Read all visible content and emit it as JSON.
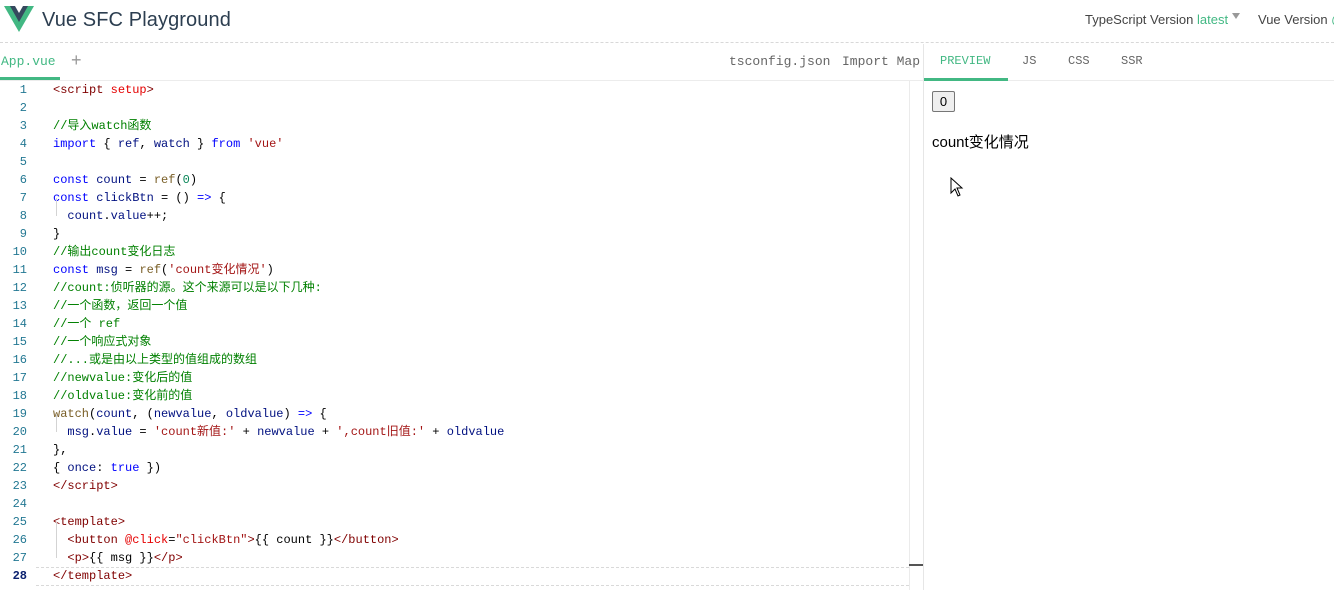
{
  "header": {
    "title": "Vue SFC Playground",
    "ts_label": "TypeScript Version",
    "ts_value": "latest",
    "vue_label": "Vue Version",
    "vue_value": "@"
  },
  "editor_tabs": {
    "active_file": "App.vue",
    "add_label": "+",
    "tsconfig": "tsconfig.json",
    "import_map": "Import Map"
  },
  "preview_tabs": [
    "PREVIEW",
    "JS",
    "CSS",
    "SSR"
  ],
  "editor": {
    "active_line": 28,
    "lines": [
      [
        [
          "c-angle",
          "<"
        ],
        [
          "c-tag",
          "script"
        ],
        [
          "c-plain",
          " "
        ],
        [
          "c-attr",
          "setup"
        ],
        [
          "c-angle",
          ">"
        ]
      ],
      [],
      [
        [
          "c-cmt",
          "//导入watch函数"
        ]
      ],
      [
        [
          "c-kw",
          "import"
        ],
        [
          "c-plain",
          " { "
        ],
        [
          "c-var",
          "ref"
        ],
        [
          "c-plain",
          ", "
        ],
        [
          "c-var",
          "watch"
        ],
        [
          "c-plain",
          " } "
        ],
        [
          "c-kw",
          "from"
        ],
        [
          "c-plain",
          " "
        ],
        [
          "c-str",
          "'vue'"
        ]
      ],
      [],
      [
        [
          "c-kw",
          "const"
        ],
        [
          "c-plain",
          " "
        ],
        [
          "c-var",
          "count"
        ],
        [
          "c-plain",
          " = "
        ],
        [
          "c-fn",
          "ref"
        ],
        [
          "c-plain",
          "("
        ],
        [
          "c-num",
          "0"
        ],
        [
          "c-plain",
          ")"
        ]
      ],
      [
        [
          "c-kw",
          "const"
        ],
        [
          "c-plain",
          " "
        ],
        [
          "c-var",
          "clickBtn"
        ],
        [
          "c-plain",
          " = () "
        ],
        [
          "c-kw",
          "=>"
        ],
        [
          "c-plain",
          " {"
        ]
      ],
      [
        [
          "c-plain",
          "  "
        ],
        [
          "c-var",
          "count"
        ],
        [
          "c-plain",
          "."
        ],
        [
          "c-var",
          "value"
        ],
        [
          "c-plain",
          "++;"
        ]
      ],
      [
        [
          "c-plain",
          "}"
        ]
      ],
      [
        [
          "c-cmt",
          "//输出count变化日志"
        ]
      ],
      [
        [
          "c-kw",
          "const"
        ],
        [
          "c-plain",
          " "
        ],
        [
          "c-var",
          "msg"
        ],
        [
          "c-plain",
          " = "
        ],
        [
          "c-fn",
          "ref"
        ],
        [
          "c-plain",
          "("
        ],
        [
          "c-str",
          "'count变化情况'"
        ],
        [
          "c-plain",
          ")"
        ]
      ],
      [
        [
          "c-cmt",
          "//count:侦听器的源。这个来源可以是以下几种:"
        ]
      ],
      [
        [
          "c-cmt",
          "//一个函数，返回一个值"
        ]
      ],
      [
        [
          "c-cmt",
          "//一个 ref"
        ]
      ],
      [
        [
          "c-cmt",
          "//一个响应式对象"
        ]
      ],
      [
        [
          "c-cmt",
          "//...或是由以上类型的值组成的数组"
        ]
      ],
      [
        [
          "c-cmt",
          "//newvalue:变化后的值"
        ]
      ],
      [
        [
          "c-cmt",
          "//oldvalue:变化前的值"
        ]
      ],
      [
        [
          "c-fn",
          "watch"
        ],
        [
          "c-plain",
          "("
        ],
        [
          "c-var",
          "count"
        ],
        [
          "c-plain",
          ", ("
        ],
        [
          "c-var",
          "newvalue"
        ],
        [
          "c-plain",
          ", "
        ],
        [
          "c-var",
          "oldvalue"
        ],
        [
          "c-plain",
          ") "
        ],
        [
          "c-kw",
          "=>"
        ],
        [
          "c-plain",
          " {"
        ]
      ],
      [
        [
          "c-plain",
          "  "
        ],
        [
          "c-var",
          "msg"
        ],
        [
          "c-plain",
          "."
        ],
        [
          "c-var",
          "value"
        ],
        [
          "c-plain",
          " = "
        ],
        [
          "c-str",
          "'count新值:'"
        ],
        [
          "c-plain",
          " + "
        ],
        [
          "c-var",
          "newvalue"
        ],
        [
          "c-plain",
          " + "
        ],
        [
          "c-str",
          "',count旧值:'"
        ],
        [
          "c-plain",
          " + "
        ],
        [
          "c-var",
          "oldvalue"
        ]
      ],
      [
        [
          "c-plain",
          "},"
        ]
      ],
      [
        [
          "c-plain",
          "{ "
        ],
        [
          "c-var",
          "once"
        ],
        [
          "c-plain",
          ": "
        ],
        [
          "c-kw",
          "true"
        ],
        [
          "c-plain",
          " })"
        ]
      ],
      [
        [
          "c-angle",
          "</"
        ],
        [
          "c-tag",
          "script"
        ],
        [
          "c-angle",
          ">"
        ]
      ],
      [],
      [
        [
          "c-angle",
          "<"
        ],
        [
          "c-tag",
          "template"
        ],
        [
          "c-angle",
          ">"
        ]
      ],
      [
        [
          "c-plain",
          "  "
        ],
        [
          "c-angle",
          "<"
        ],
        [
          "c-tag",
          "button"
        ],
        [
          "c-plain",
          " "
        ],
        [
          "c-attr",
          "@click"
        ],
        [
          "c-plain",
          "="
        ],
        [
          "c-str",
          "\"clickBtn\""
        ],
        [
          "c-angle",
          ">"
        ],
        [
          "c-plain",
          "{{ count }}"
        ],
        [
          "c-angle",
          "</"
        ],
        [
          "c-tag",
          "button"
        ],
        [
          "c-angle",
          ">"
        ]
      ],
      [
        [
          "c-plain",
          "  "
        ],
        [
          "c-angle",
          "<"
        ],
        [
          "c-tag",
          "p"
        ],
        [
          "c-angle",
          ">"
        ],
        [
          "c-plain",
          "{{ msg }}"
        ],
        [
          "c-angle",
          "</"
        ],
        [
          "c-tag",
          "p"
        ],
        [
          "c-angle",
          ">"
        ]
      ],
      [
        [
          "c-angle",
          "</"
        ],
        [
          "c-tag",
          "template"
        ],
        [
          "c-angle",
          ">"
        ]
      ]
    ]
  },
  "preview": {
    "button_label": "0",
    "message": "count变化情况"
  },
  "colors": {
    "accent": "#42b883",
    "title": "#2c3e50"
  },
  "icons": {
    "logo": "vue-logo-icon",
    "cursor": "mouse-pointer-icon"
  }
}
